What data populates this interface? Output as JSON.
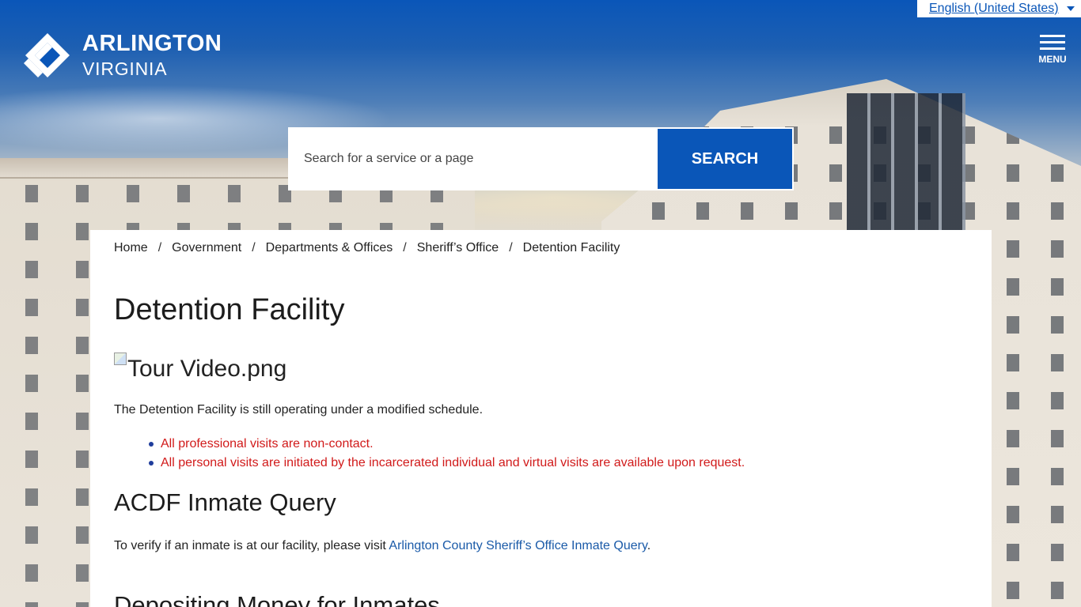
{
  "language": {
    "selected": "English (United States)"
  },
  "logo": {
    "title": "ARLINGTON",
    "subtitle": "VIRGINIA"
  },
  "menu": {
    "label": "MENU"
  },
  "search": {
    "placeholder": "Search for a service or a page",
    "button_label": "SEARCH"
  },
  "breadcrumb": [
    {
      "label": "Home"
    },
    {
      "label": "Government"
    },
    {
      "label": "Departments & Offices"
    },
    {
      "label": "Sheriff’s Office"
    },
    {
      "label": "Detention Facility"
    }
  ],
  "breadcrumb_separator": "/",
  "page": {
    "title": "Detention Facility",
    "image_alt": "Tour Video.png",
    "intro": "The Detention Facility is still operating under a modified schedule.",
    "alerts": [
      "All professional visits are non-contact.",
      "All personal visits are initiated by the incarcerated individual and virtual visits are available upon request."
    ],
    "section1": {
      "heading": "ACDF Inmate Query",
      "text_before": "To verify if an inmate is at our facility, please visit ",
      "link_text": "Arlington County Sheriff’s Office Inmate Query",
      "text_after": "."
    },
    "section2": {
      "heading": "Depositing Money for Inmates"
    }
  },
  "colors": {
    "brand_blue": "#0a56b8",
    "alert_red": "#d11a1a",
    "link_blue": "#1a5aa8"
  }
}
